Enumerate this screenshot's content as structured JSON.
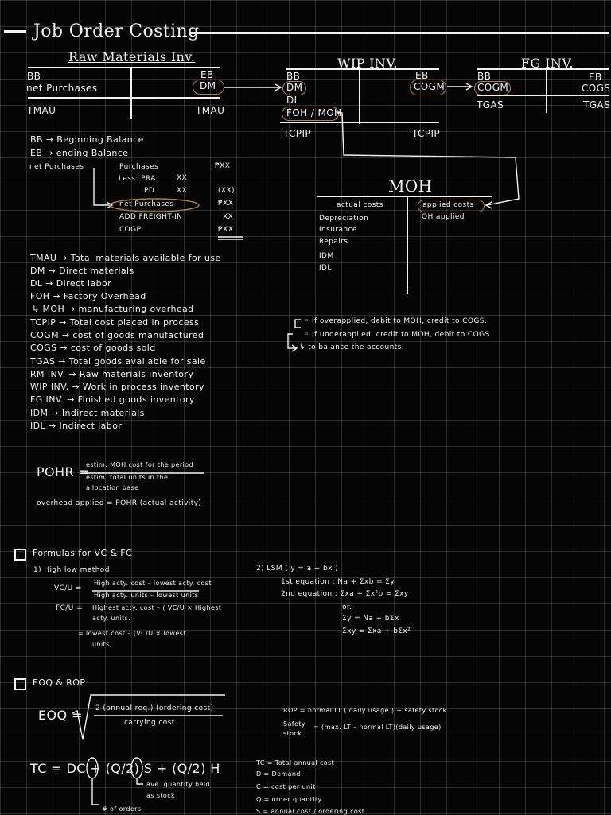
{
  "title": "Job Order Costing",
  "raw": {
    "header": "Raw Materials Inv.",
    "bb": "BB",
    "net_purchases": "net Purchases",
    "tmau_left": "TMAU",
    "eb": "EB",
    "dm": "DM",
    "tmau_right": "TMAU"
  },
  "wip": {
    "header": "WIP INV.",
    "bb": "BB",
    "dm": "DM",
    "dl": "DL",
    "foh": "FOH / MOH",
    "tcpip_left": "TCPIP",
    "eb": "EB",
    "cogm": "COGM",
    "tcpip_right": "TCPIP"
  },
  "fg": {
    "header": "FG INV.",
    "bb": "BB",
    "cogm": "COGM",
    "tgas_left": "TGAS",
    "eb": "EB",
    "cogs": "COGS",
    "tgas_right": "TGAS"
  },
  "defs_top": [
    "BB → Beginning Balance",
    "EB → ending Balance"
  ],
  "net_purchases": {
    "label": "net Purchases",
    "rows": [
      {
        "l": "Purchases",
        "v": "₱XX"
      },
      {
        "l": "Less: PRA",
        "v": "XX"
      },
      {
        "l": "PD",
        "v": "XX"
      },
      {
        "l": "net Purchases",
        "v": "(XX)"
      },
      {
        "l": "",
        "v": "₱XX"
      },
      {
        "l": "ADD FREIGHT-IN",
        "v": "XX"
      },
      {
        "l": "COGP",
        "v": "₱XX"
      }
    ]
  },
  "moh": {
    "title": "MOH",
    "actual": "actual costs",
    "applied": "applied costs",
    "oh_applied": "OH applied",
    "items": [
      "Depreciation",
      "Insurance",
      "Repairs",
      "IDM",
      "IDL"
    ]
  },
  "defs": [
    "TMAU → Total materials available for use",
    "DM → Direct materials",
    "DL → Direct labor",
    "FOH → Factory Overhead",
    "↳ MOH → manufacturing overhead",
    "TCPIP → Total cost placed in process",
    "COGM → cost of goods manufactured",
    "COGS → cost of goods sold",
    "TGAS → Total goods available for sale",
    "RM INV. → Raw materials inventory",
    "WIP INV. → Work in process inventory",
    "FG INV. → Finished goods inventory",
    "IDM → Indirect materials",
    "IDL → Indirect labor"
  ],
  "notes": [
    "◦ If overapplied, debit to MOH, credit to COGS.",
    "◦ If underapplied, credit to MOH, debit to COGS",
    "↳ to balance the accounts."
  ],
  "pohr": {
    "label": "POHR =",
    "num": "estim. MOH cost for the period",
    "den1": "estim. total units in the",
    "den2": "allocation base",
    "applied": "overhead applied = POHR (actual activity)"
  },
  "formulas": {
    "heading": "Formulas for VC & FC",
    "hl_title": "1) High low method",
    "vcu_label": "VC/U =",
    "vcu_num": "High acty. cost – lowest acty. cost",
    "vcu_den": "High acty. units – lowest units",
    "fcu_label": "FC/U =",
    "fcu_1": "Highest acty. cost – ( VC/U × Highest",
    "fcu_2": "acty. units.",
    "fcu_3": "= lowest cost – (VC/U × lowest",
    "fcu_4": "units)",
    "lsm_title": "2) LSM ( y = a + bx )",
    "eq1": "1st equation : Na + Σxb = Σy",
    "eq2": "2nd equation : Σxa + Σx²b = Σxy",
    "or": "or.",
    "alt1": "Σy = Na + bΣx",
    "alt2": "Σxy = Σxa + bΣx²"
  },
  "eoq": {
    "heading": "EOQ & ROP",
    "label": "EOQ =",
    "num": "2 (annual req.) (ordering cost)",
    "den": "carrying cost",
    "rop": "ROP = normal LT ( daily usage ) + safety stock",
    "ss_label": "Safety stock",
    "ss": "= (max. LT – normal LT)(daily usage)",
    "tc": "TC = DC + (Q/2) S + (Q/2) H",
    "ave": "ave. quantity held",
    "as_stock": "as stock",
    "num_orders": "# of orders",
    "defs": [
      "TC = Total annual cost",
      "D = Demand",
      "C = cost per unit",
      "Q = order quantity",
      "S = annual cost / ordering cost"
    ]
  }
}
